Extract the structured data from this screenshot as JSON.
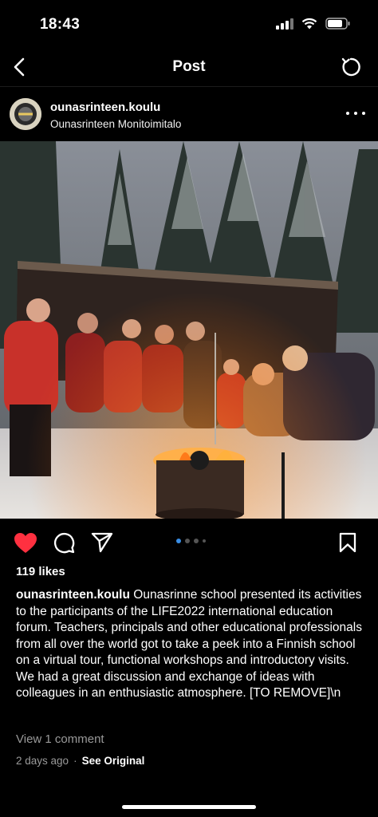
{
  "status_bar": {
    "time": "18:43"
  },
  "nav": {
    "title": "Post"
  },
  "post": {
    "username": "ounasrinteen.koulu",
    "location": "Ounasrinteen Monitoimitalo",
    "likes": "119 likes",
    "caption_user": "ounasrinteen.koulu",
    "caption_text": "Ounasrinne school presented its activities to the participants of the LIFE2022 international education forum. Teachers, principals and other educational professionals from all over the world got to take a peek into a Finnish school on a virtual tour, functional workshops and introductory visits. We had a great discussion and exchange of ideas with colleagues in an enthusiastic atmosphere. [TO REMOVE]\\n",
    "view_comments": "View 1 comment",
    "time_ago": "2 days ago",
    "separator": "·",
    "see_original": "See Original",
    "liked": true,
    "carousel_index": 1,
    "carousel_count": 4
  },
  "colors": {
    "like": "#ff3040",
    "carousel_active": "#3a8ee6"
  }
}
